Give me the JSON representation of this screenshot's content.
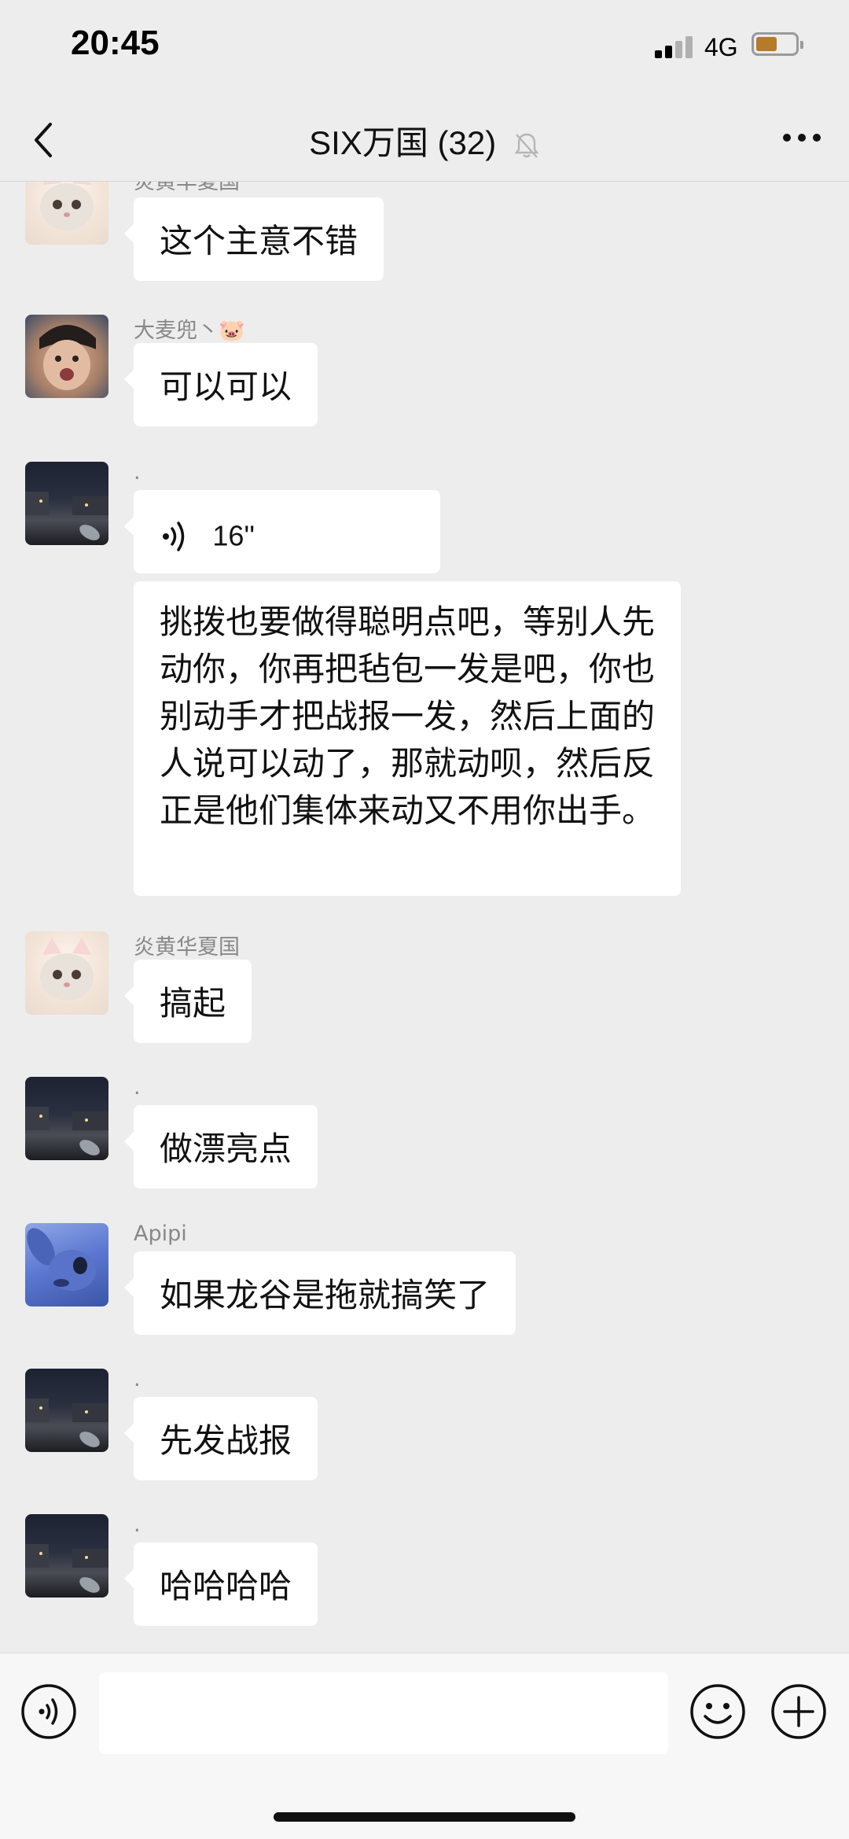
{
  "status_bar": {
    "time": "20:45",
    "network": "4G"
  },
  "header": {
    "title": "SIX万国 (32)"
  },
  "messages": [
    {
      "sender": "炎黄华夏国",
      "text": "这个主意不错"
    },
    {
      "sender": "大麦兜丶🐷",
      "text": "可以可以"
    },
    {
      "sender": ".",
      "voice_duration": "16''"
    },
    {
      "text": "挑拨也要做得聪明点吧，等别人先动你，你再把毡包一发是吧，你也别动手才把战报一发，然后上面的人说可以动了，那就动呗，然后反正是他们集体来动又不用你出手。"
    },
    {
      "sender": "炎黄华夏国",
      "text": "搞起"
    },
    {
      "sender": ".",
      "text": "做漂亮点"
    },
    {
      "sender": "Apipi",
      "text": "如果龙谷是拖就搞笑了"
    },
    {
      "sender": ".",
      "text": "先发战报"
    },
    {
      "sender": ".",
      "text": "哈哈哈哈"
    }
  ],
  "input": {
    "value": ""
  },
  "colors": {
    "background": "#ededed",
    "bubble": "#ffffff",
    "battery": "#b57a2a"
  },
  "icons": [
    "back-icon",
    "mute-icon",
    "more-icon",
    "voice-icon",
    "emoji-icon",
    "plus-icon"
  ]
}
